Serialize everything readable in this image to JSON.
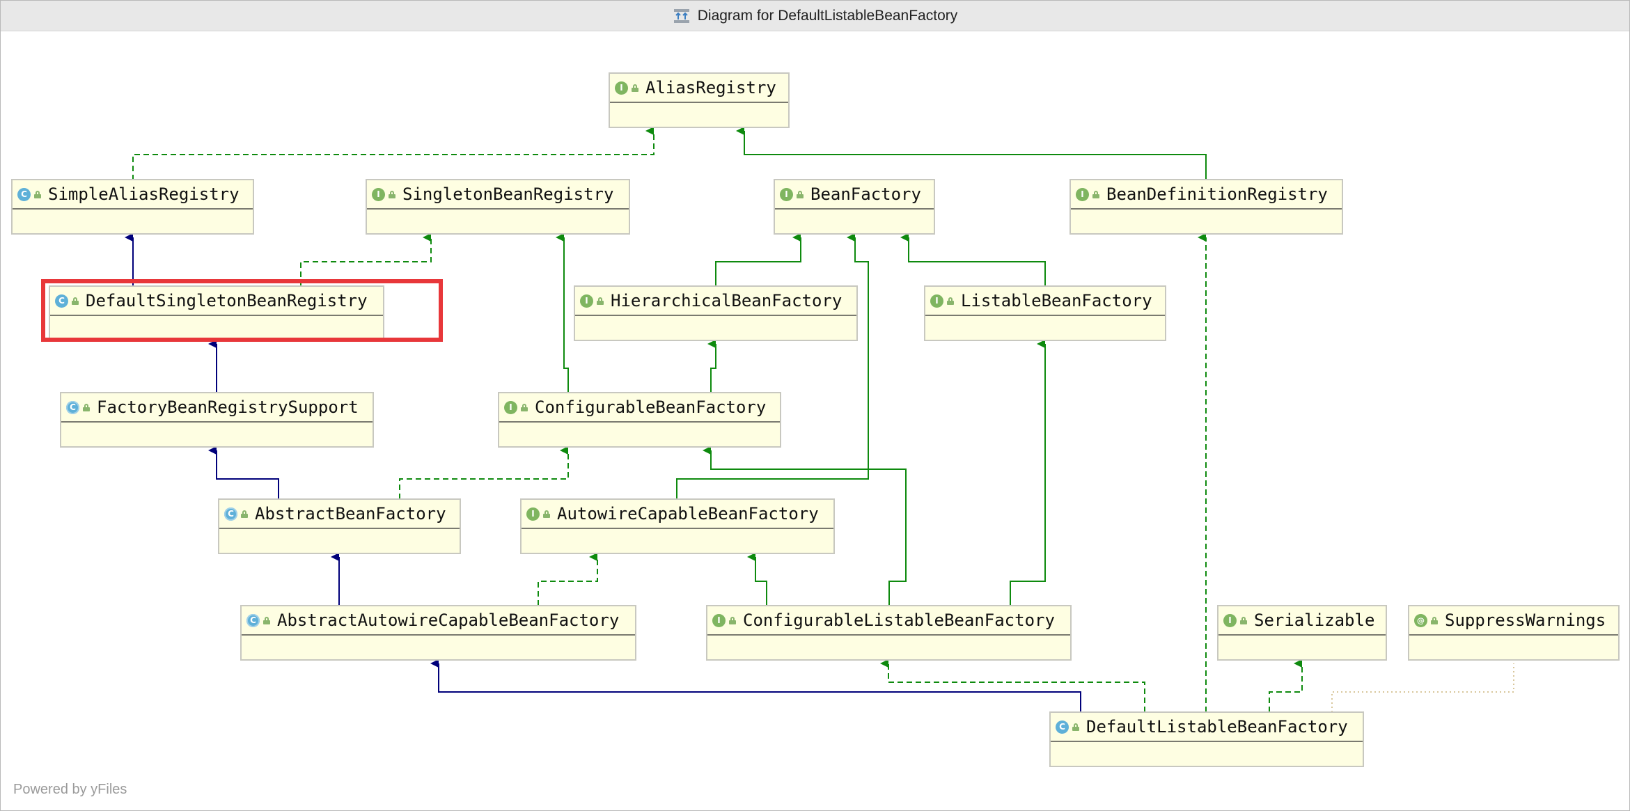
{
  "window": {
    "title": "Diagram for DefaultListableBeanFactory"
  },
  "colors": {
    "implements": "#0e8a0e",
    "extends": "#00007a",
    "highlight": "#e8373a",
    "node_fill": "#fefee2"
  },
  "nodes": [
    {
      "id": "alias-registry",
      "name": "AliasRegistry",
      "kind": "interface",
      "icon": "interface-icon"
    },
    {
      "id": "simple-alias-registry",
      "name": "SimpleAliasRegistry",
      "kind": "class",
      "icon": "class-icon"
    },
    {
      "id": "singleton-bean-registry",
      "name": "SingletonBeanRegistry",
      "kind": "interface",
      "icon": "interface-icon"
    },
    {
      "id": "bean-factory",
      "name": "BeanFactory",
      "kind": "interface",
      "icon": "interface-icon"
    },
    {
      "id": "bean-definition-registry",
      "name": "BeanDefinitionRegistry",
      "kind": "interface",
      "icon": "interface-icon"
    },
    {
      "id": "default-singleton-bean-registry",
      "name": "DefaultSingletonBeanRegistry",
      "kind": "class",
      "icon": "class-icon"
    },
    {
      "id": "hierarchical-bean-factory",
      "name": "HierarchicalBeanFactory",
      "kind": "interface",
      "icon": "interface-icon"
    },
    {
      "id": "listable-bean-factory",
      "name": "ListableBeanFactory",
      "kind": "interface",
      "icon": "interface-icon"
    },
    {
      "id": "factory-bean-registry-support",
      "name": "FactoryBeanRegistrySupport",
      "kind": "abstract-class",
      "icon": "abstract-class-icon"
    },
    {
      "id": "configurable-bean-factory",
      "name": "ConfigurableBeanFactory",
      "kind": "interface",
      "icon": "interface-icon"
    },
    {
      "id": "abstract-bean-factory",
      "name": "AbstractBeanFactory",
      "kind": "abstract-class",
      "icon": "abstract-class-icon"
    },
    {
      "id": "autowire-capable-bean-factory",
      "name": "AutowireCapableBeanFactory",
      "kind": "interface",
      "icon": "interface-icon"
    },
    {
      "id": "abstract-autowire-capable-bean-factory",
      "name": "AbstractAutowireCapableBeanFactory",
      "kind": "abstract-class",
      "icon": "abstract-class-icon"
    },
    {
      "id": "configurable-listable-bean-factory",
      "name": "ConfigurableListableBeanFactory",
      "kind": "interface",
      "icon": "interface-icon"
    },
    {
      "id": "serializable",
      "name": "Serializable",
      "kind": "interface",
      "icon": "interface-icon"
    },
    {
      "id": "suppress-warnings",
      "name": "SuppressWarnings",
      "kind": "annotation",
      "icon": "annotation-icon"
    },
    {
      "id": "default-listable-bean-factory",
      "name": "DefaultListableBeanFactory",
      "kind": "class",
      "icon": "class-icon"
    }
  ],
  "kind_glyphs": {
    "interface": "I",
    "class": "C",
    "abstract-class": "C",
    "annotation": "@"
  },
  "highlighted_node": "default-singleton-bean-registry",
  "edges": [
    {
      "from": "simple-alias-registry",
      "to": "alias-registry",
      "type": "implements"
    },
    {
      "from": "bean-definition-registry",
      "to": "alias-registry",
      "type": "extends-interface"
    },
    {
      "from": "default-singleton-bean-registry",
      "to": "simple-alias-registry",
      "type": "extends"
    },
    {
      "from": "default-singleton-bean-registry",
      "to": "singleton-bean-registry",
      "type": "implements"
    },
    {
      "from": "hierarchical-bean-factory",
      "to": "bean-factory",
      "type": "extends-interface"
    },
    {
      "from": "listable-bean-factory",
      "to": "bean-factory",
      "type": "extends-interface"
    },
    {
      "from": "autowire-capable-bean-factory",
      "to": "bean-factory",
      "type": "extends-interface"
    },
    {
      "from": "factory-bean-registry-support",
      "to": "default-singleton-bean-registry",
      "type": "extends"
    },
    {
      "from": "configurable-bean-factory",
      "to": "singleton-bean-registry",
      "type": "extends-interface"
    },
    {
      "from": "configurable-bean-factory",
      "to": "hierarchical-bean-factory",
      "type": "extends-interface"
    },
    {
      "from": "abstract-bean-factory",
      "to": "factory-bean-registry-support",
      "type": "extends"
    },
    {
      "from": "abstract-bean-factory",
      "to": "configurable-bean-factory",
      "type": "implements"
    },
    {
      "from": "abstract-autowire-capable-bean-factory",
      "to": "abstract-bean-factory",
      "type": "extends"
    },
    {
      "from": "abstract-autowire-capable-bean-factory",
      "to": "autowire-capable-bean-factory",
      "type": "implements"
    },
    {
      "from": "configurable-listable-bean-factory",
      "to": "autowire-capable-bean-factory",
      "type": "extends-interface"
    },
    {
      "from": "configurable-listable-bean-factory",
      "to": "configurable-bean-factory",
      "type": "extends-interface"
    },
    {
      "from": "configurable-listable-bean-factory",
      "to": "listable-bean-factory",
      "type": "extends-interface"
    },
    {
      "from": "default-listable-bean-factory",
      "to": "abstract-autowire-capable-bean-factory",
      "type": "extends"
    },
    {
      "from": "default-listable-bean-factory",
      "to": "configurable-listable-bean-factory",
      "type": "implements"
    },
    {
      "from": "default-listable-bean-factory",
      "to": "bean-definition-registry",
      "type": "implements"
    },
    {
      "from": "default-listable-bean-factory",
      "to": "serializable",
      "type": "implements"
    },
    {
      "from": "default-listable-bean-factory",
      "to": "suppress-warnings",
      "type": "annotated-with"
    }
  ],
  "footer": {
    "watermark": "Powered by yFiles"
  }
}
